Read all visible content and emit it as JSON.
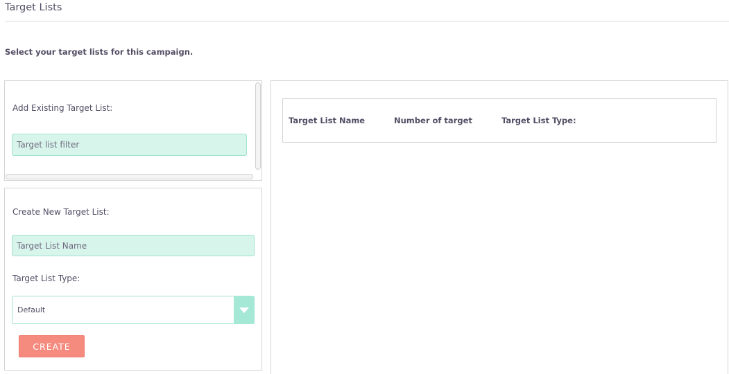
{
  "header": {
    "title": "Target Lists",
    "instructions": "Select your target lists for this campaign."
  },
  "existing_panel": {
    "label": "Add Existing Target List:",
    "filter_placeholder": "Target list filter"
  },
  "create_panel": {
    "label": "Create New Target List:",
    "name_placeholder": "Target List Name",
    "type_label": "Target List Type:",
    "type_selected": "Default",
    "create_button": "CREATE"
  },
  "table": {
    "columns": [
      "Target List Name",
      "Number of target",
      "Target List Type:"
    ]
  },
  "colors": {
    "input_bg": "#d8f5ec",
    "accent": "#a5e8d6",
    "button": "#f58a7f"
  }
}
